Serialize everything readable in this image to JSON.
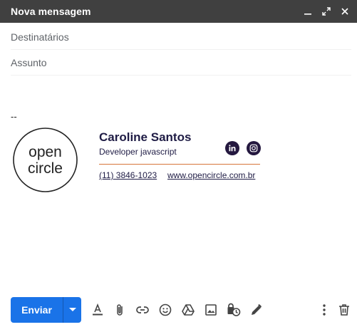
{
  "window": {
    "title": "Nova mensagem",
    "header_bg": "#404040"
  },
  "fields": {
    "recipients_placeholder": "Destinatários",
    "subject_placeholder": "Assunto"
  },
  "signature": {
    "separator": "--",
    "logo_line1": "open",
    "logo_line2": "circle",
    "name": "Caroline Santos",
    "role": "Developer javascript",
    "phone": "(11) 3846-1023",
    "website": "www.opencircle.com.br",
    "accent_color": "#d6763a",
    "text_color": "#1f1c45",
    "social": [
      "linkedin-icon",
      "instagram-icon"
    ]
  },
  "toolbar": {
    "send_label": "Enviar",
    "send_color": "#1a73e8",
    "icons": [
      "format-text-icon",
      "attach-icon",
      "link-icon",
      "emoji-icon",
      "drive-icon",
      "image-icon",
      "confidential-icon",
      "signature-icon",
      "more-options-icon",
      "trash-icon"
    ]
  }
}
